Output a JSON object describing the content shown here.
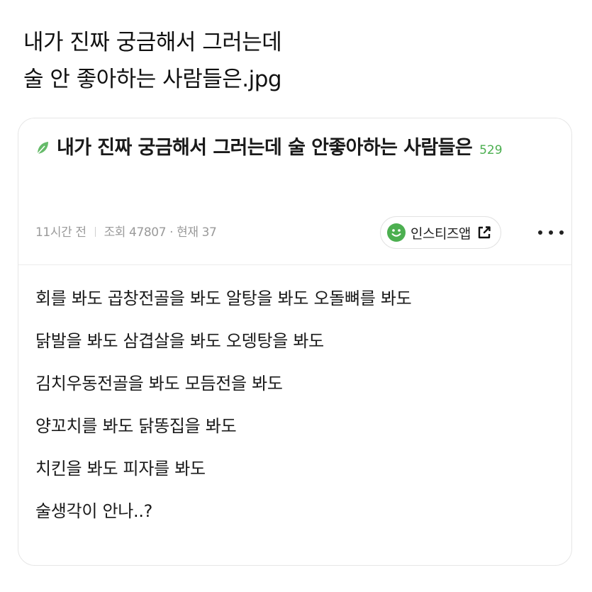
{
  "caption": {
    "line1": "내가 진짜 궁금해서 그러는데",
    "line2": "술 안 좋아하는 사람들은.jpg"
  },
  "post": {
    "title": "내가 진짜 궁금해서 그러는데 술 안좋아하는 사람들은",
    "comment_count": "529",
    "time": "11시간 전",
    "views": "조회 47807 · 현재 37",
    "app_button_label": "인스티즈앱",
    "icons": {
      "title_icon": "leaf-icon",
      "app_icon": "smile-icon",
      "open_icon": "external-link-icon",
      "more_icon": "more-dots-icon"
    },
    "body": [
      "회를 봐도 곱창전골을 봐도 알탕을 봐도 오돌뼈를 봐도",
      "닭발을 봐도 삼겹살을 봐도 오뎅탕을 봐도",
      "김치우동전골을 봐도 모듬전을 봐도",
      "양꼬치를 봐도 닭똥집을 봐도",
      "치킨을 봐도 피자를 봐도",
      "술생각이 안나..?"
    ]
  },
  "colors": {
    "accent_green": "#4caf50",
    "meta_gray": "#9a9a9a",
    "border": "#e6e6e6"
  }
}
